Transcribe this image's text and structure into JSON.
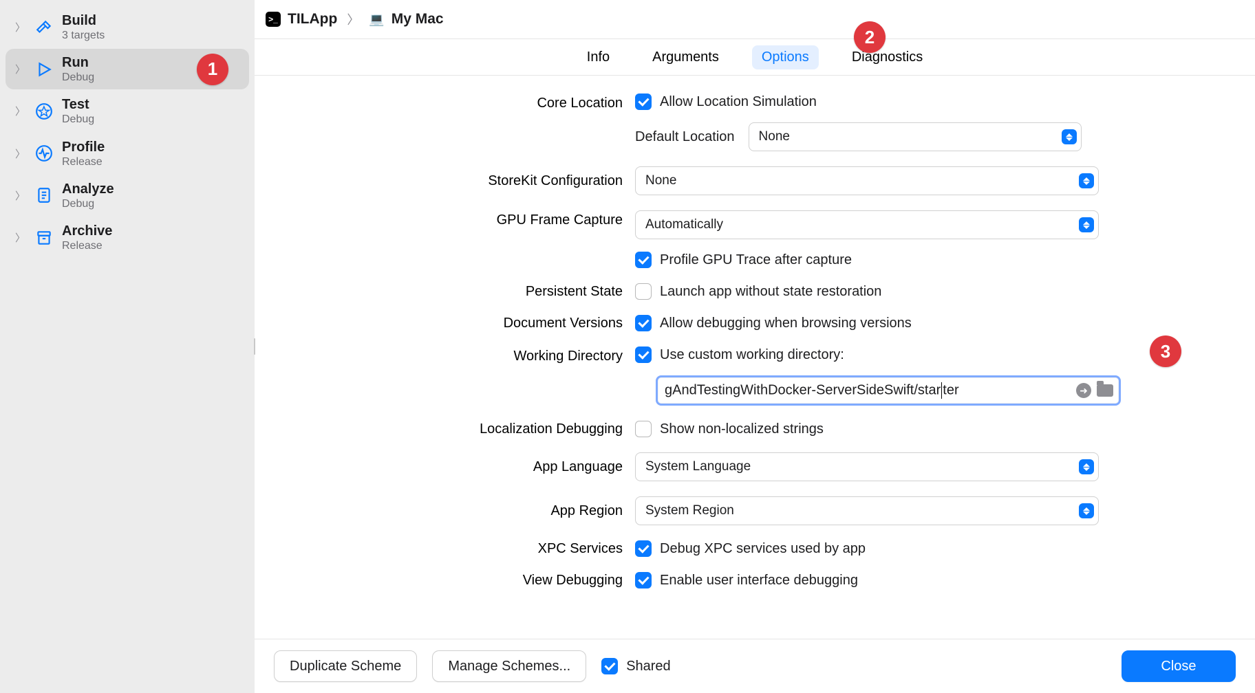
{
  "breadcrumb": {
    "app": "TILApp",
    "target": "My Mac"
  },
  "tabs": {
    "items": [
      "Info",
      "Arguments",
      "Options",
      "Diagnostics"
    ],
    "active": "Options"
  },
  "callouts": {
    "c1": "1",
    "c2": "2",
    "c3": "3"
  },
  "sidebar": {
    "items": [
      {
        "title": "Build",
        "sub": "3 targets",
        "icon": "hammer"
      },
      {
        "title": "Run",
        "sub": "Debug",
        "icon": "play"
      },
      {
        "title": "Test",
        "sub": "Debug",
        "icon": "gauge"
      },
      {
        "title": "Profile",
        "sub": "Release",
        "icon": "activity"
      },
      {
        "title": "Analyze",
        "sub": "Debug",
        "icon": "doc"
      },
      {
        "title": "Archive",
        "sub": "Release",
        "icon": "box"
      }
    ]
  },
  "options": {
    "core_location": {
      "label": "Core Location",
      "allow_simulation": "Allow Location Simulation",
      "default_location_label": "Default Location",
      "default_location_value": "None"
    },
    "storekit": {
      "label": "StoreKit Configuration",
      "value": "None"
    },
    "gpu": {
      "label": "GPU Frame Capture",
      "value": "Automatically",
      "profile_after_capture": "Profile GPU Trace after capture"
    },
    "persistent_state": {
      "label": "Persistent State",
      "text": "Launch app without state restoration"
    },
    "document_versions": {
      "label": "Document Versions",
      "text": "Allow debugging when browsing versions"
    },
    "working_directory": {
      "label": "Working Directory",
      "use_custom": "Use custom working directory:",
      "path_left": "gAndTestingWithDocker-ServerSideSwift/star",
      "path_right": "ter"
    },
    "localization_debugging": {
      "label": "Localization Debugging",
      "text": "Show non-localized strings"
    },
    "app_language": {
      "label": "App Language",
      "value": "System Language"
    },
    "app_region": {
      "label": "App Region",
      "value": "System Region"
    },
    "xpc": {
      "label": "XPC Services",
      "text": "Debug XPC services used by app"
    },
    "view_debugging": {
      "label": "View Debugging",
      "text": "Enable user interface debugging"
    }
  },
  "footer": {
    "duplicate": "Duplicate Scheme",
    "manage": "Manage Schemes...",
    "shared": "Shared",
    "close": "Close"
  }
}
